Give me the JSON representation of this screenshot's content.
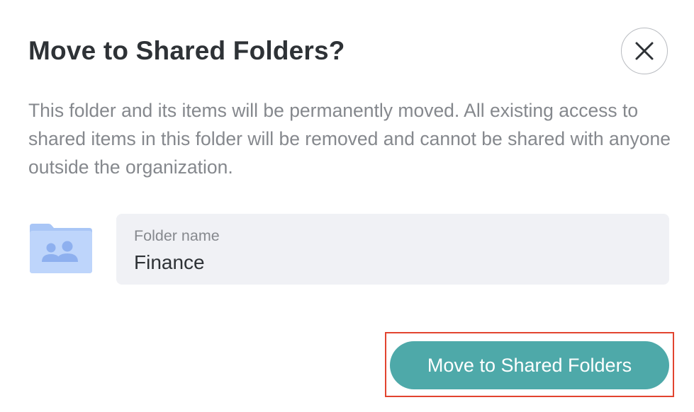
{
  "dialog": {
    "title": "Move to Shared Folders?",
    "close_icon": "close-icon",
    "description": "This folder and its items will be permanently moved. All existing access to shared items in this folder will be removed and cannot be shared with anyone outside the organization.",
    "folder_icon": "shared-folder-icon",
    "folder_name_field": {
      "label": "Folder name",
      "value": "Finance"
    },
    "primary_button": {
      "label": "Move to Shared Folders"
    }
  },
  "colors": {
    "title_text": "#2e3236",
    "body_text": "#85888d",
    "field_background": "#f0f1f5",
    "primary_button": "#4ea9a9",
    "highlight_border": "#e2442f",
    "folder_icon_fill": "#bed5fb",
    "folder_icon_person": "#8eb0ef"
  }
}
